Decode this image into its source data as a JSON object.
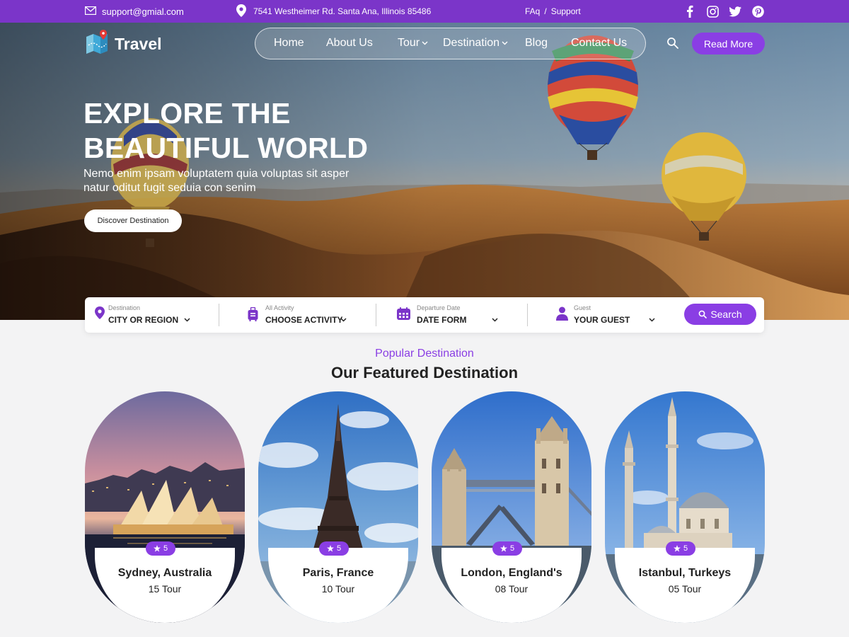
{
  "topbar": {
    "email": "support@gmial.com",
    "address": "7541 Westheimer Rd. Santa Ana, Illinois 85486",
    "faq": "FAq",
    "separator": "/",
    "support": "Support",
    "social_icons": [
      "facebook-icon",
      "instagram-icon",
      "twitter-icon",
      "pinterest-icon"
    ]
  },
  "brand": {
    "name": "Travel"
  },
  "nav": {
    "items": [
      {
        "label": "Home"
      },
      {
        "label": "About Us"
      },
      {
        "label": "Tour"
      },
      {
        "label": "Destination"
      },
      {
        "label": "Blog"
      },
      {
        "label": "Contact Us"
      }
    ],
    "cta": "Read More"
  },
  "hero": {
    "title_line1": "EXPLORE THE",
    "title_line2": "BEAUTIFUL WORLD",
    "subtitle": "Nemo enim ipsam voluptatem quia voluptas sit asper natur oditut fugit seduia con senim",
    "button": "Discover Destination"
  },
  "search": {
    "fields": [
      {
        "label": "Destination",
        "value": "CITY OR REGION",
        "icon": "location-pin-icon"
      },
      {
        "label": "All Activity",
        "value": "CHOOSE ACTIVITY",
        "icon": "luggage-icon"
      },
      {
        "label": "Departure Date",
        "value": "DATE FORM",
        "icon": "calendar-icon"
      },
      {
        "label": "Guest",
        "value": "YOUR GUEST",
        "icon": "user-icon"
      }
    ],
    "button": "Search"
  },
  "featured": {
    "eyebrow": "Popular Destination",
    "title": "Our Featured Destination",
    "cards": [
      {
        "name": "Sydney, Australia",
        "tours": "15 Tour",
        "rating": "5"
      },
      {
        "name": "Paris, France",
        "tours": "10 Tour",
        "rating": "5"
      },
      {
        "name": "London, England's",
        "tours": "08 Tour",
        "rating": "5"
      },
      {
        "name": "Istanbul, Turkeys",
        "tours": "05 Tour",
        "rating": "5"
      }
    ]
  },
  "colors": {
    "brand_purple": "#7b35c9",
    "button_purple": "#8a3ee4",
    "page_bg": "#f3f3f4"
  }
}
